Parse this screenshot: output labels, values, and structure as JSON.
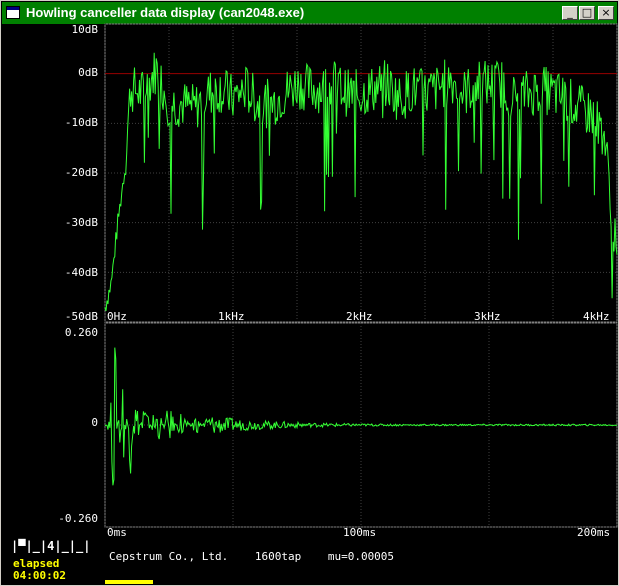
{
  "window": {
    "title": "Howling canceller data display (can2048.exe)"
  },
  "titlebar_buttons": [
    {
      "name": "minimize-button",
      "glyph": "_"
    },
    {
      "name": "maximize-button",
      "glyph": "□"
    },
    {
      "name": "close-button",
      "glyph": "×"
    }
  ],
  "colors": {
    "trace": "#33ff33",
    "grid": "#404040",
    "zero_line": "#990000",
    "titlebar": "#008000",
    "elapsed": "#ffff00"
  },
  "status": {
    "company": "Cepstrum Co., Ltd.",
    "taps": "1600tap",
    "mu": "mu=0.00005",
    "indicator": "|▀|_|4|_|_|",
    "elapsed_label": "elapsed",
    "elapsed_time": "04:00:02"
  },
  "chart_data": [
    {
      "type": "line",
      "ylim": [
        -50,
        10
      ],
      "xlim": [
        0,
        4000
      ],
      "y_tick_labels": [
        "10dB",
        "0dB",
        "-10dB",
        "-20dB",
        "-30dB",
        "-40dB",
        "-50dB"
      ],
      "y_ticks": [
        10,
        0,
        -10,
        -20,
        -30,
        -40,
        -50
      ],
      "x_tick_labels": [
        "0Hz",
        "1kHz",
        "2kHz",
        "3kHz",
        "4kHz"
      ],
      "x_ticks": [
        0,
        1000,
        2000,
        3000,
        4000
      ],
      "reference_line": 0,
      "grid": true,
      "x": [
        0,
        50,
        100,
        150,
        200,
        300,
        400,
        500,
        600,
        700,
        800,
        900,
        1000,
        1100,
        1200,
        1300,
        1400,
        1500,
        1600,
        1700,
        1800,
        1900,
        2000,
        2100,
        2200,
        2300,
        2400,
        2500,
        2600,
        2700,
        2800,
        2900,
        3000,
        3100,
        3200,
        3300,
        3400,
        3500,
        3600,
        3700,
        3800,
        3900,
        4000
      ],
      "y": [
        -47,
        -42,
        -30,
        -20,
        -3,
        -4,
        1,
        -6,
        -6,
        -7,
        -4,
        -3,
        -5,
        -3,
        -6,
        -6,
        -4,
        -2,
        -3,
        -3,
        -2,
        -4,
        -4,
        -3,
        -2,
        -5,
        -3,
        -4,
        -3,
        -1,
        -4,
        -2,
        -2,
        -2,
        -5,
        -4,
        -3,
        -4,
        -5,
        -7,
        -8,
        -12,
        -38
      ]
    },
    {
      "type": "line",
      "ylim": [
        -0.26,
        0.26
      ],
      "xlim": [
        0,
        200
      ],
      "y_tick_labels": [
        "0.260",
        "0",
        "-0.260"
      ],
      "y_ticks": [
        0.26,
        0,
        -0.26
      ],
      "x_tick_labels": [
        "0ms",
        "100ms",
        "200ms"
      ],
      "x_ticks": [
        0,
        100,
        200
      ],
      "grid": true,
      "x": [
        0,
        2,
        4,
        5,
        6,
        7,
        8,
        10,
        12,
        15,
        20,
        25,
        30,
        35,
        40,
        50,
        60,
        70,
        80,
        100,
        120,
        150,
        200
      ],
      "y": [
        0,
        0.02,
        0.26,
        -0.18,
        0.14,
        -0.15,
        0.07,
        -0.12,
        0.08,
        -0.07,
        0.06,
        -0.05,
        0.04,
        -0.03,
        0.025,
        0.015,
        0.01,
        0.008,
        0.005,
        0.003,
        0.002,
        0.001,
        0
      ]
    }
  ]
}
